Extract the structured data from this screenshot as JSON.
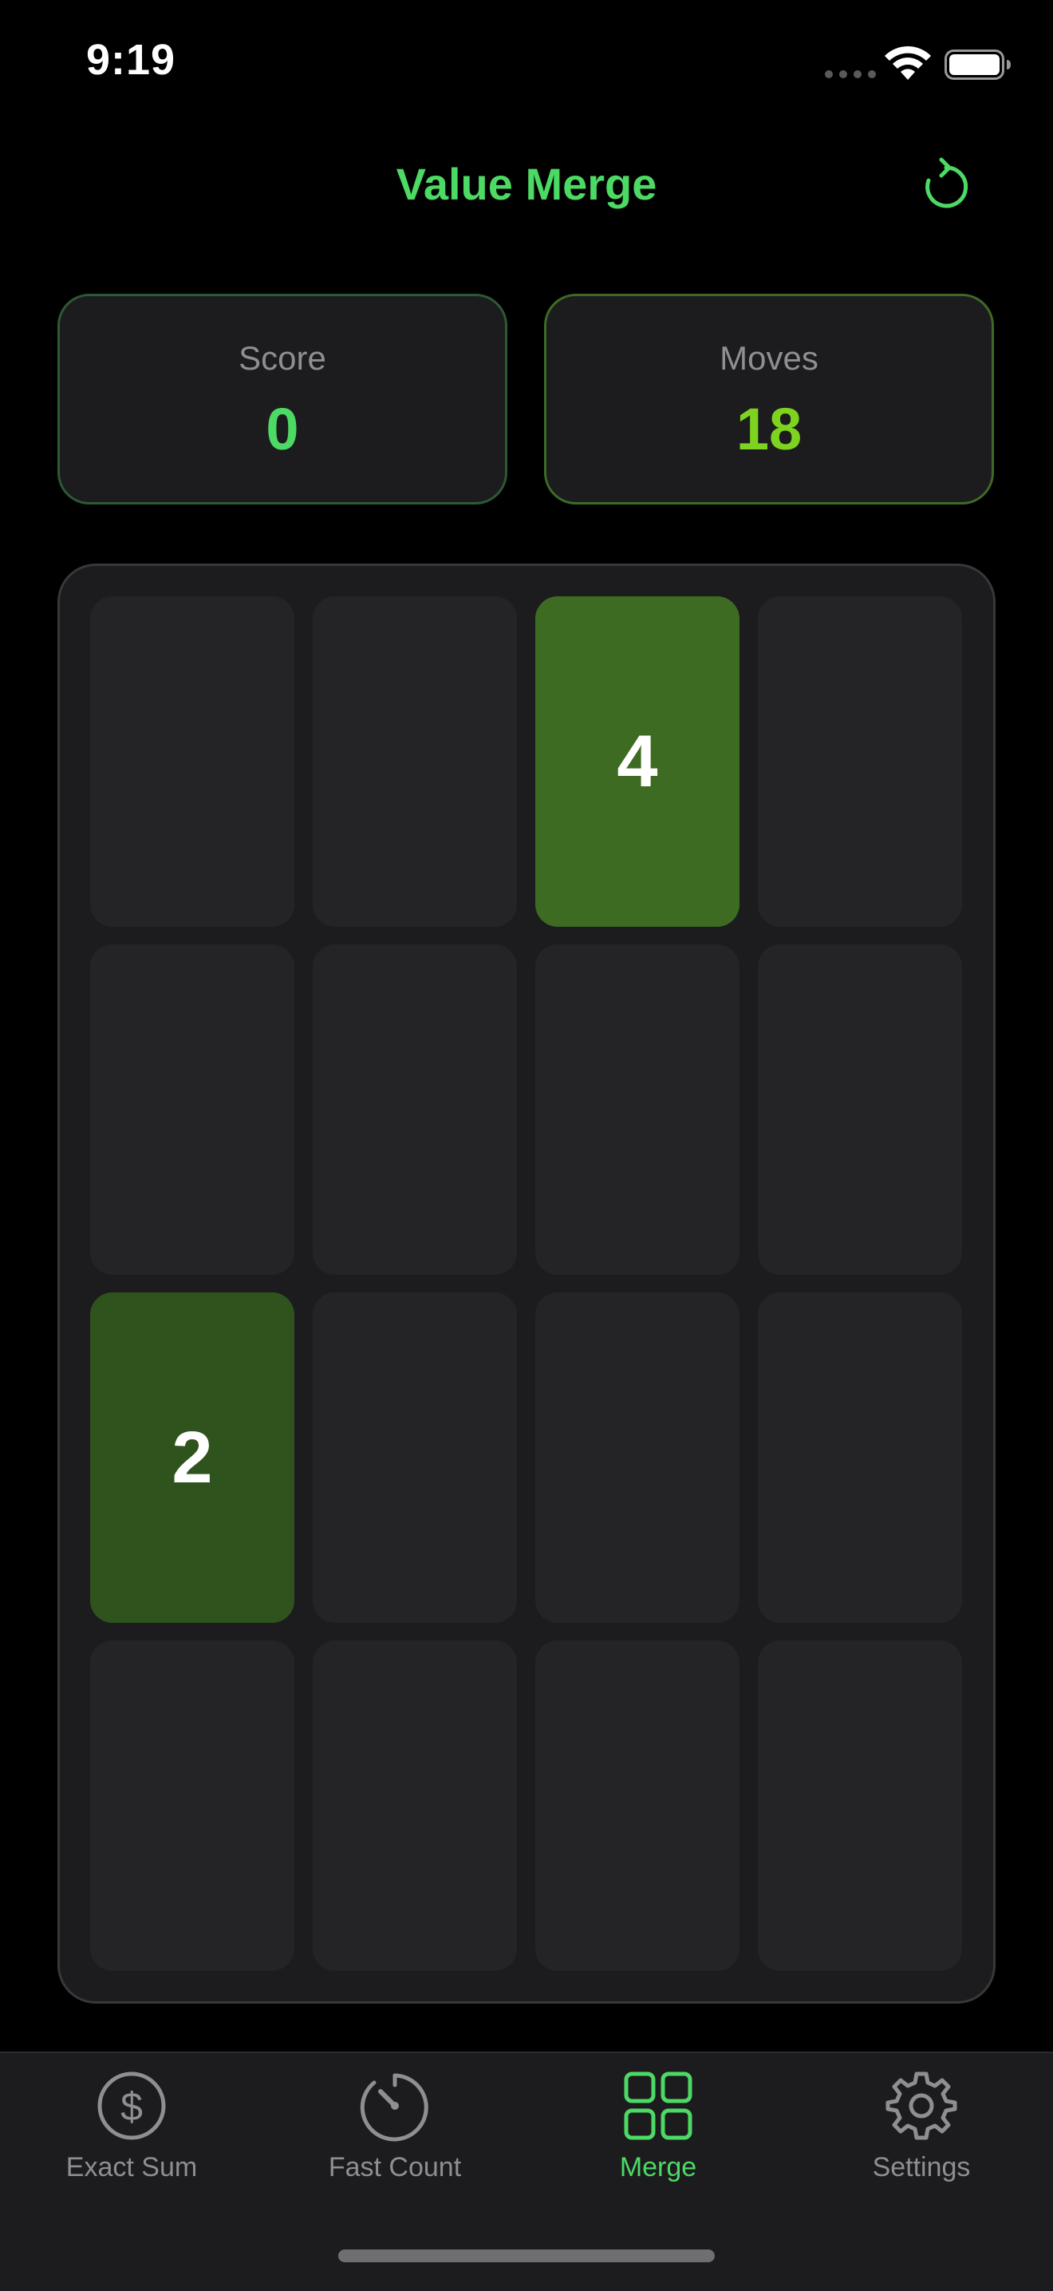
{
  "status_bar": {
    "time": "9:19"
  },
  "header": {
    "title": "Value Merge",
    "reset_icon": "refresh-icon"
  },
  "stats": {
    "score_label": "Score",
    "score_value": "0",
    "moves_label": "Moves",
    "moves_value": "18"
  },
  "board": {
    "rows": [
      [
        "",
        "",
        "4",
        ""
      ],
      [
        "",
        "",
        "",
        ""
      ],
      [
        "2",
        "",
        "",
        ""
      ],
      [
        "",
        "",
        "",
        ""
      ]
    ]
  },
  "tabs": [
    {
      "label": "Exact Sum",
      "icon": "dollar-circle-icon",
      "active": false
    },
    {
      "label": "Fast Count",
      "icon": "timer-icon",
      "active": false
    },
    {
      "label": "Merge",
      "icon": "grid-icon",
      "active": true
    },
    {
      "label": "Settings",
      "icon": "gear-icon",
      "active": false
    }
  ],
  "colors": {
    "accent": "#4cd964",
    "moves_accent": "#7ed321",
    "tile_2": "#2f531d",
    "tile_4": "#3d6b21",
    "inactive": "#8e8e93"
  }
}
